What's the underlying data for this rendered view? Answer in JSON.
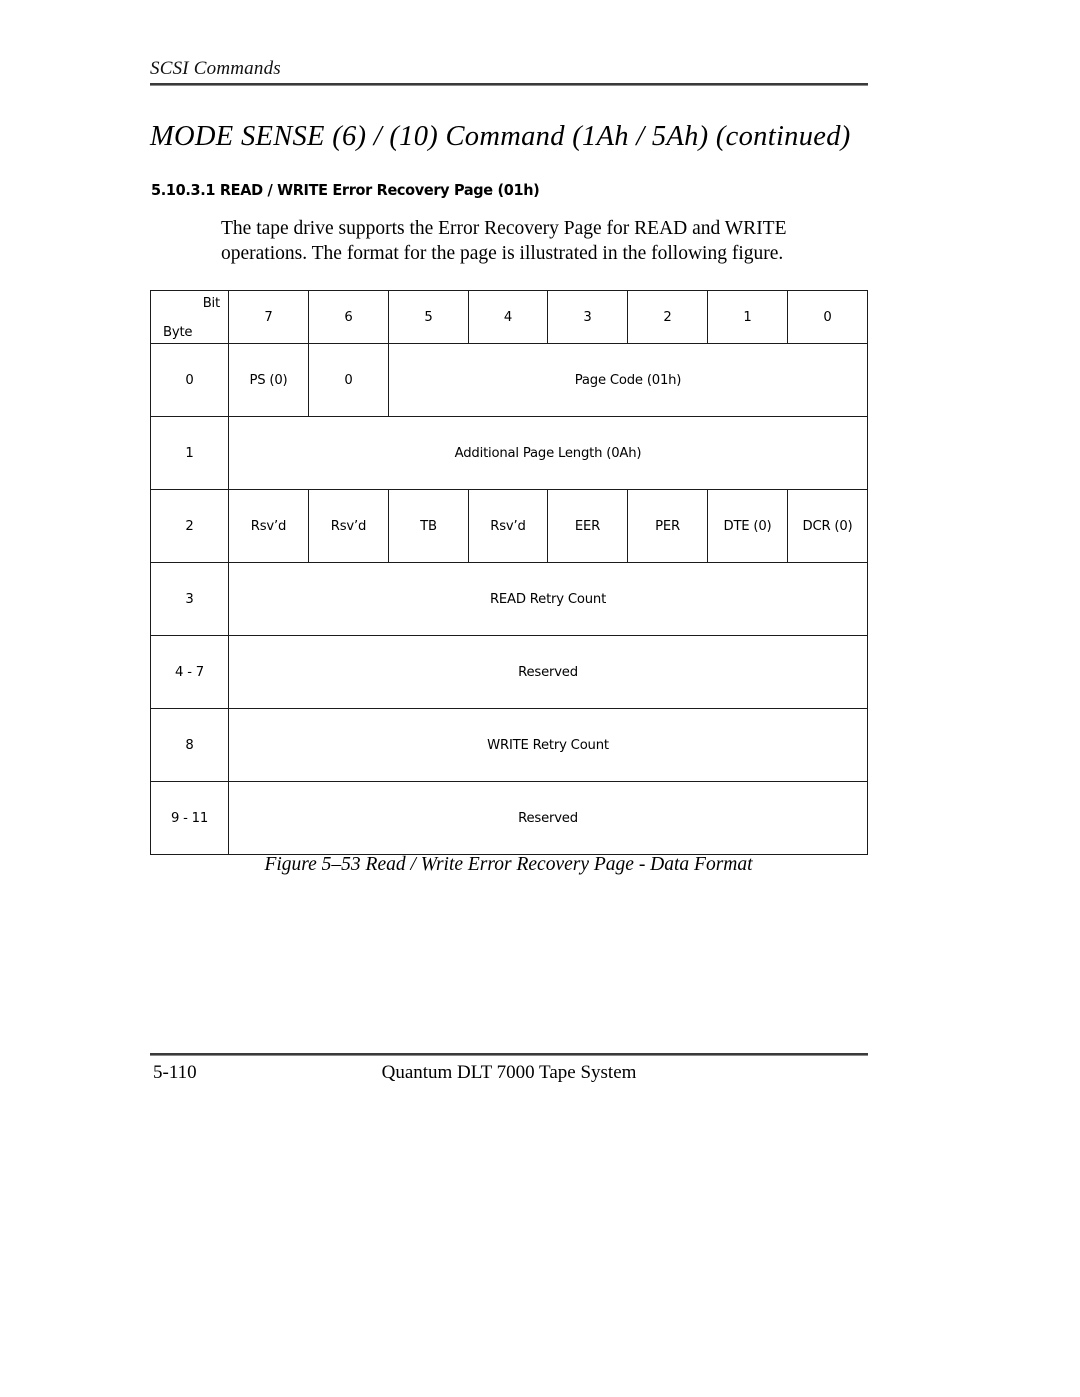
{
  "header": {
    "running_title": "SCSI Commands"
  },
  "title": "MODE SENSE  (6) / (10) Command  (1Ah / 5Ah) (continued)",
  "section": {
    "number": "5.10.3.1",
    "heading": "5.10.3.1  READ / WRITE Error Recovery Page (01h)"
  },
  "body": {
    "line1": "The tape drive supports the Error Recovery Page for READ and WRITE",
    "line2": "operations. The format for the page is illustrated in the following figure."
  },
  "table": {
    "corner": {
      "bit_label": "Bit",
      "byte_label": "Byte"
    },
    "bit_headers": [
      "7",
      "6",
      "5",
      "4",
      "3",
      "2",
      "1",
      "0"
    ],
    "rows": [
      {
        "byte": "0",
        "cells": [
          {
            "text": "PS (0)",
            "span": 1
          },
          {
            "text": "0",
            "span": 1
          },
          {
            "text": "Page Code (01h)",
            "span": 6
          }
        ]
      },
      {
        "byte": "1",
        "cells": [
          {
            "text": "Additional Page Length (0Ah)",
            "span": 8
          }
        ]
      },
      {
        "byte": "2",
        "cells": [
          {
            "text": "Rsv’d",
            "span": 1
          },
          {
            "text": "Rsv’d",
            "span": 1
          },
          {
            "text": "TB",
            "span": 1
          },
          {
            "text": "Rsv’d",
            "span": 1
          },
          {
            "text": "EER",
            "span": 1
          },
          {
            "text": "PER",
            "span": 1
          },
          {
            "text": "DTE (0)",
            "span": 1
          },
          {
            "text": "DCR (0)",
            "span": 1
          }
        ]
      },
      {
        "byte": "3",
        "cells": [
          {
            "text": "READ Retry Count",
            "span": 8
          }
        ]
      },
      {
        "byte": "4 - 7",
        "cells": [
          {
            "text": "Reserved",
            "span": 8
          }
        ]
      },
      {
        "byte": "8",
        "cells": [
          {
            "text": "WRITE Retry Count",
            "span": 8
          }
        ]
      },
      {
        "byte": "9 - 11",
        "cells": [
          {
            "text": "Reserved",
            "span": 8
          }
        ]
      }
    ]
  },
  "figure_caption": "Figure 5–53  Read / Write Error Recovery Page  - Data Format",
  "footer": {
    "page_number": "5-110",
    "product": "Quantum DLT 7000 Tape System"
  }
}
